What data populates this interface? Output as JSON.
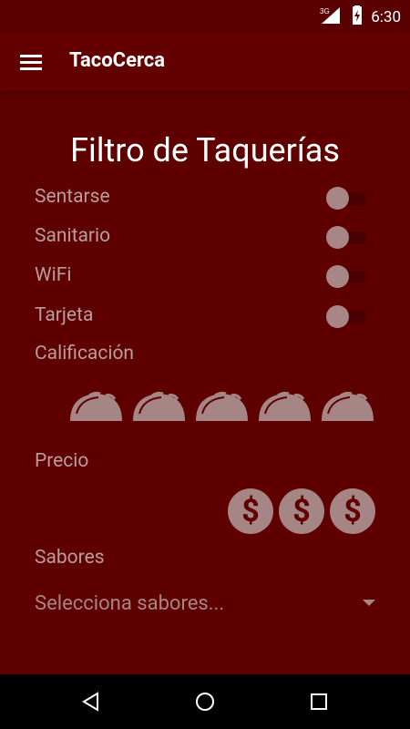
{
  "status": {
    "network": "3G",
    "time": "6:30",
    "icons": [
      "signal-icon",
      "battery-charging-icon"
    ]
  },
  "app_bar": {
    "menu_icon": "hamburger-menu-icon",
    "title": "TacoCerca"
  },
  "filters": {
    "title": "Filtro de Taquerías",
    "toggles": [
      {
        "label": "Sentarse",
        "on": false
      },
      {
        "label": "Sanitario",
        "on": false
      },
      {
        "label": "WiFi",
        "on": false
      },
      {
        "label": "Tarjeta",
        "on": false
      }
    ],
    "rating": {
      "label": "Calificación",
      "icon": "taco-icon",
      "count": 5,
      "selected": 0
    },
    "price": {
      "label": "Precio",
      "symbol": "$",
      "count": 3,
      "selected": 0
    },
    "flavors": {
      "label": "Sabores",
      "placeholder": "Selecciona sabores..."
    }
  },
  "nav": {
    "back_icon": "back-icon",
    "home_icon": "home-icon",
    "recents_icon": "recents-icon"
  },
  "colors": {
    "background": "#5e0000",
    "app_bar": "#620000",
    "muted": "#a68585",
    "text_label": "#b99c9c"
  }
}
